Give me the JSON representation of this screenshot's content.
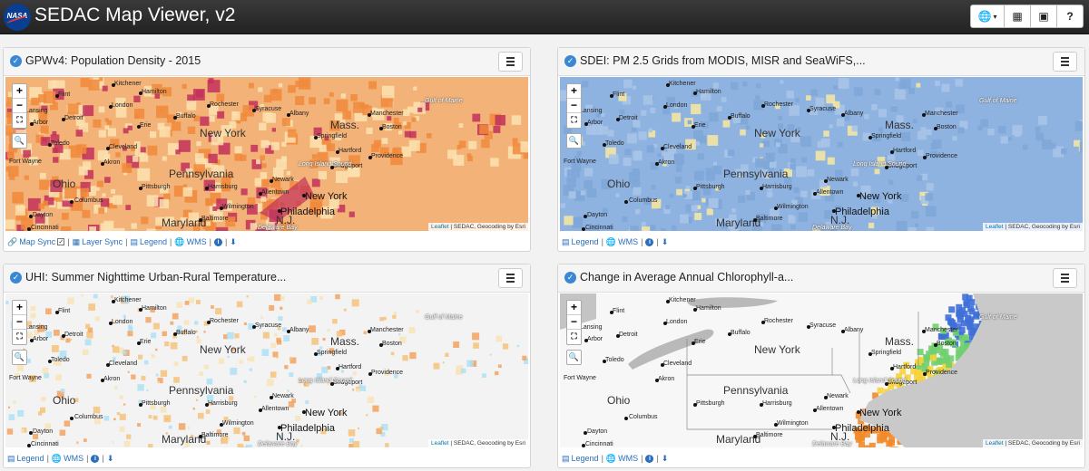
{
  "app": {
    "logo_text": "NASA",
    "title": "SEDAC Map Viewer, v2",
    "toolbar": [
      {
        "icon": "globe-icon",
        "glyph": "🌐",
        "caret": "▾"
      },
      {
        "icon": "grid-icon",
        "glyph": "▦"
      },
      {
        "icon": "image-icon",
        "glyph": "▣"
      },
      {
        "icon": "help-icon",
        "glyph": "?"
      }
    ]
  },
  "colors": {
    "accent": "#2a6ebd",
    "check": "#3a87d4",
    "popdensity_high": "#c2305a",
    "popdensity_mid": "#f08a3c",
    "popdensity_low": "#fbe2b0",
    "pm25_low": "#7ea6d8",
    "pm25_high": "#f3e6a3",
    "chl_blue": "#3f6fd8",
    "chl_orange": "#f28a2a",
    "land": "#dedede",
    "lake": "#b9b9b9"
  },
  "map_common": {
    "zoom_in": "+",
    "zoom_out": "−",
    "fullscreen": "⛶",
    "search": "🔍",
    "attrib_link": "Leaflet",
    "attrib_text": " | SEDAC, Geocoding by Esri",
    "labels": {
      "kitchener": "Kitchener",
      "hamilton": "Hamilton",
      "london": "London",
      "flint": "Flint",
      "lansing": "Lansing",
      "arbor": "Arbor",
      "detroit": "Detroit",
      "toledo": "Toledo",
      "cleveland": "Cleveland",
      "akron": "Akron",
      "erie": "Erie",
      "fort_wayne": "Fort Wayne",
      "columbus": "Columbus",
      "dayton": "Dayton",
      "cincinnati": "Cincinnati",
      "pittsburgh": "Pittsburgh",
      "harrisburg": "Harrisburg",
      "allentown": "Allentown",
      "wilmington": "Wilmington",
      "baltimore": "Baltimore",
      "newark": "Newark",
      "bridgeport": "Bridgeport",
      "hartford": "Hartford",
      "springfield": "Springfield",
      "albany": "Albany",
      "providence": "Providence",
      "boston": "Boston",
      "manchester": "Manchester",
      "rochester": "Rochester",
      "syracuse": "Syracuse",
      "buffalo": "Buffalo",
      "gulf_of_maine": "Gulf of Maine",
      "long_island_sound": "Long Island Sound",
      "delaware_bay": "Delaware Bay",
      "new_york_state": "New York",
      "pennsylvania": "Pennsylvania",
      "ohio": "Ohio",
      "maryland": "Maryland",
      "mass": "Mass.",
      "nj": "N.J.",
      "new_york_city": "New York",
      "philadelphia": "Philadelphia"
    }
  },
  "panels": [
    {
      "title": "GPWv4: Population Density - 2015",
      "footer": {
        "map_sync": "Map Sync",
        "map_sync_checked": "✓",
        "layer_sync": "Layer Sync",
        "legend": "Legend",
        "wms": "WMS",
        "info": "i",
        "download": "⬇",
        "sep": "|"
      }
    },
    {
      "title": "SDEI: PM 2.5 Grids from MODIS, MISR and SeaWiFS,...",
      "footer": {
        "legend": "Legend",
        "wms": "WMS",
        "info": "i",
        "download": "⬇",
        "sep": "|"
      }
    },
    {
      "title": "UHI: Summer Nighttime Urban-Rural Temperature...",
      "footer": {
        "legend": "Legend",
        "wms": "WMS",
        "info": "i",
        "download": "⬇",
        "sep": "|"
      }
    },
    {
      "title": "Change in Average Annual Chlorophyll-a...",
      "footer": {
        "legend": "Legend",
        "wms": "WMS",
        "info": "i",
        "download": "⬇",
        "sep": "|"
      }
    }
  ]
}
